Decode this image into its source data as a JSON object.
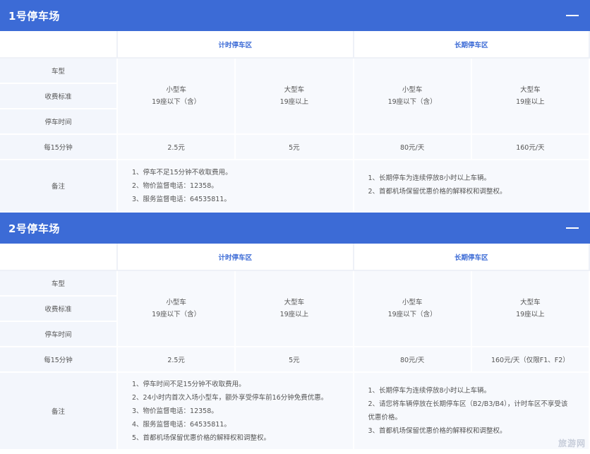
{
  "lots": [
    {
      "title": "1号停车场",
      "zones": [
        "计时停车区",
        "长期停车区"
      ],
      "row_labels": {
        "type": "车型",
        "standard": "收费标准",
        "time": "停车时间",
        "per15": "每15分钟",
        "notes": "备注"
      },
      "vehicles": [
        {
          "name": "小型车",
          "seats": "19座以下（含）"
        },
        {
          "name": "大型车",
          "seats": "19座以上"
        },
        {
          "name": "小型车",
          "seats": "19座以下（含）"
        },
        {
          "name": "大型车",
          "seats": "19座以上"
        }
      ],
      "prices": [
        "2.5元",
        "5元",
        "80元/天",
        "160元/天"
      ],
      "notes_hourly": [
        "1、停车不足15分钟不收取费用。",
        "2、物价监督电话：12358。",
        "3、服务监督电话：64535811。"
      ],
      "notes_long": [
        "1、长期停车为连续停放8小时以上车辆。",
        "2、首都机场保留优惠价格的解释权和调整权。"
      ]
    },
    {
      "title": "2号停车场",
      "zones": [
        "计时停车区",
        "长期停车区"
      ],
      "row_labels": {
        "type": "车型",
        "standard": "收费标准",
        "time": "停车时间",
        "per15": "每15分钟",
        "notes": "备注"
      },
      "vehicles": [
        {
          "name": "小型车",
          "seats": "19座以下（含）"
        },
        {
          "name": "大型车",
          "seats": "19座以上"
        },
        {
          "name": "小型车",
          "seats": "19座以下（含）"
        },
        {
          "name": "大型车",
          "seats": "19座以上"
        }
      ],
      "prices": [
        "2.5元",
        "5元",
        "80元/天",
        "160元/天（仅限F1、F2）"
      ],
      "notes_hourly": [
        "1、停车时间不足15分钟不收取费用。",
        "2、24小时内首次入场小型车，额外享受停车前16分钟免费优惠。",
        "3、物价监督电话：12358。",
        "4、服务监督电话：64535811。",
        "5、首都机场保留优惠价格的解释权和调整权。"
      ],
      "notes_long": [
        "1、长期停车为连续停放8小时以上车辆。",
        "2、请您将车辆停放在长期停车区（B2/B3/B4），计时车区不享受该",
        "优惠价格。",
        "3、首都机场保留优惠价格的解释权和调整权。"
      ]
    }
  ],
  "watermark": "旅游网",
  "icons": {
    "collapse": "minus-icon"
  },
  "colors": {
    "header": "#3c6bd6",
    "zone_text": "#3c6bd6",
    "row_bg": "#f3f6fc"
  }
}
